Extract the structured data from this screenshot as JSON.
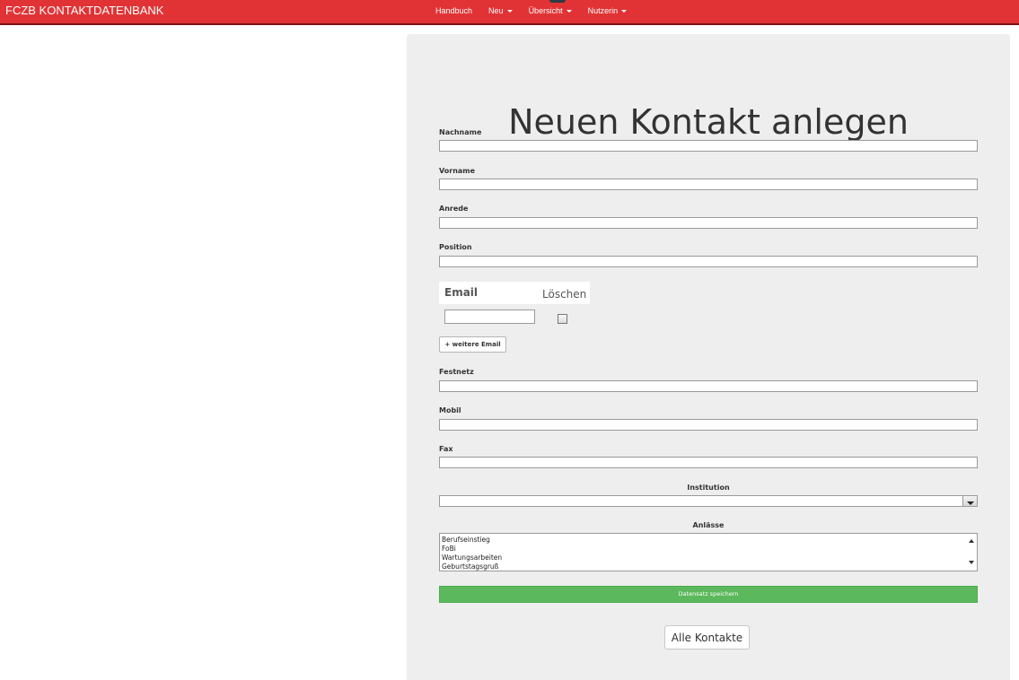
{
  "navbar": {
    "brand": "FCZB KONTAKTDATENBANK",
    "items": [
      {
        "label": "Handbuch",
        "dropdown": false
      },
      {
        "label": "Neu",
        "dropdown": true
      },
      {
        "label": "Übersicht",
        "dropdown": true
      },
      {
        "label": "Nutzerin",
        "dropdown": true
      }
    ],
    "color": "#e13335"
  },
  "form": {
    "title": "Neuen Kontakt anlegen",
    "fields": {
      "nachname": {
        "label": "Nachname",
        "value": ""
      },
      "vorname": {
        "label": "Vorname",
        "value": ""
      },
      "anrede": {
        "label": "Anrede",
        "value": ""
      },
      "position": {
        "label": "Position",
        "value": ""
      },
      "festnetz": {
        "label": "Festnetz",
        "value": ""
      },
      "mobil": {
        "label": "Mobil",
        "value": ""
      },
      "fax": {
        "label": "Fax",
        "value": ""
      }
    },
    "email": {
      "column_email": "Email",
      "column_delete": "Löschen",
      "value": "",
      "delete_checked": false,
      "add_button": "+ weitere Email"
    },
    "institution": {
      "label": "Institution",
      "selected": ""
    },
    "anlaesse": {
      "label": "Anlässe",
      "options": [
        "Berufseinstieg",
        "FoBi",
        "Wartungsarbeiten",
        "Geburtstagsgruß"
      ]
    },
    "save_button": "Datensatz speichern",
    "save_color": "#5cb85c",
    "all_contacts_button": "Alle Kontakte"
  }
}
